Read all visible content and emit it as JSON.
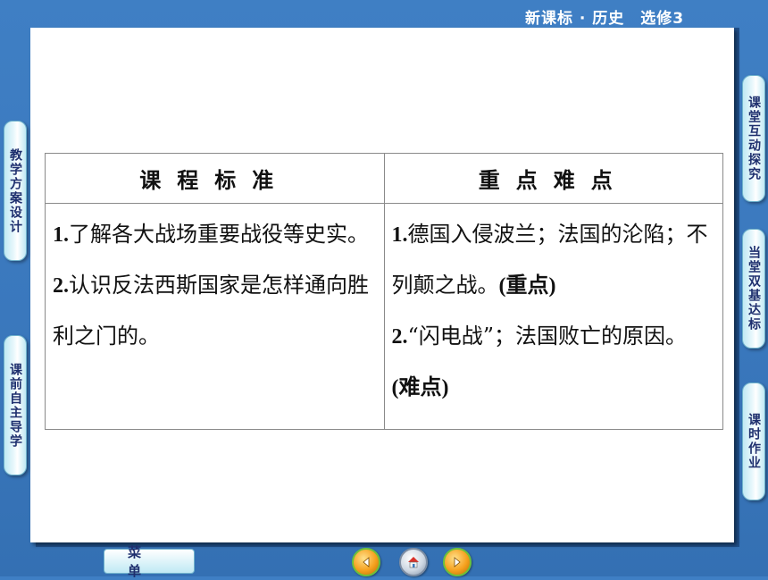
{
  "header": {
    "title": "新课标 · 历史　选修3"
  },
  "table": {
    "headers": [
      "课程标准",
      "重点难点"
    ],
    "left": [
      {
        "num": "1.",
        "text": "了解各大战场重要战役等史实。"
      },
      {
        "num": "2.",
        "text": "认识反法西斯国家是怎样通向胜利之门的。"
      }
    ],
    "right": [
      {
        "num": "1.",
        "text": "德国入侵波兰；法国的沦陷；不列颠之战。",
        "tag": "(重点)"
      },
      {
        "num": "2.",
        "text": "“闪电战”；法国败亡的原因。",
        "tag": "(难点)"
      }
    ]
  },
  "left_tabs": [
    "教学方案设计",
    "课前自主导学"
  ],
  "right_tabs": [
    "课堂互动探究",
    "当堂双基达标",
    "课时作业"
  ],
  "bottom": {
    "menu_label": "菜单"
  },
  "icons": {
    "prev": "left-arrow-icon",
    "home": "home-icon",
    "next": "right-arrow-icon"
  }
}
